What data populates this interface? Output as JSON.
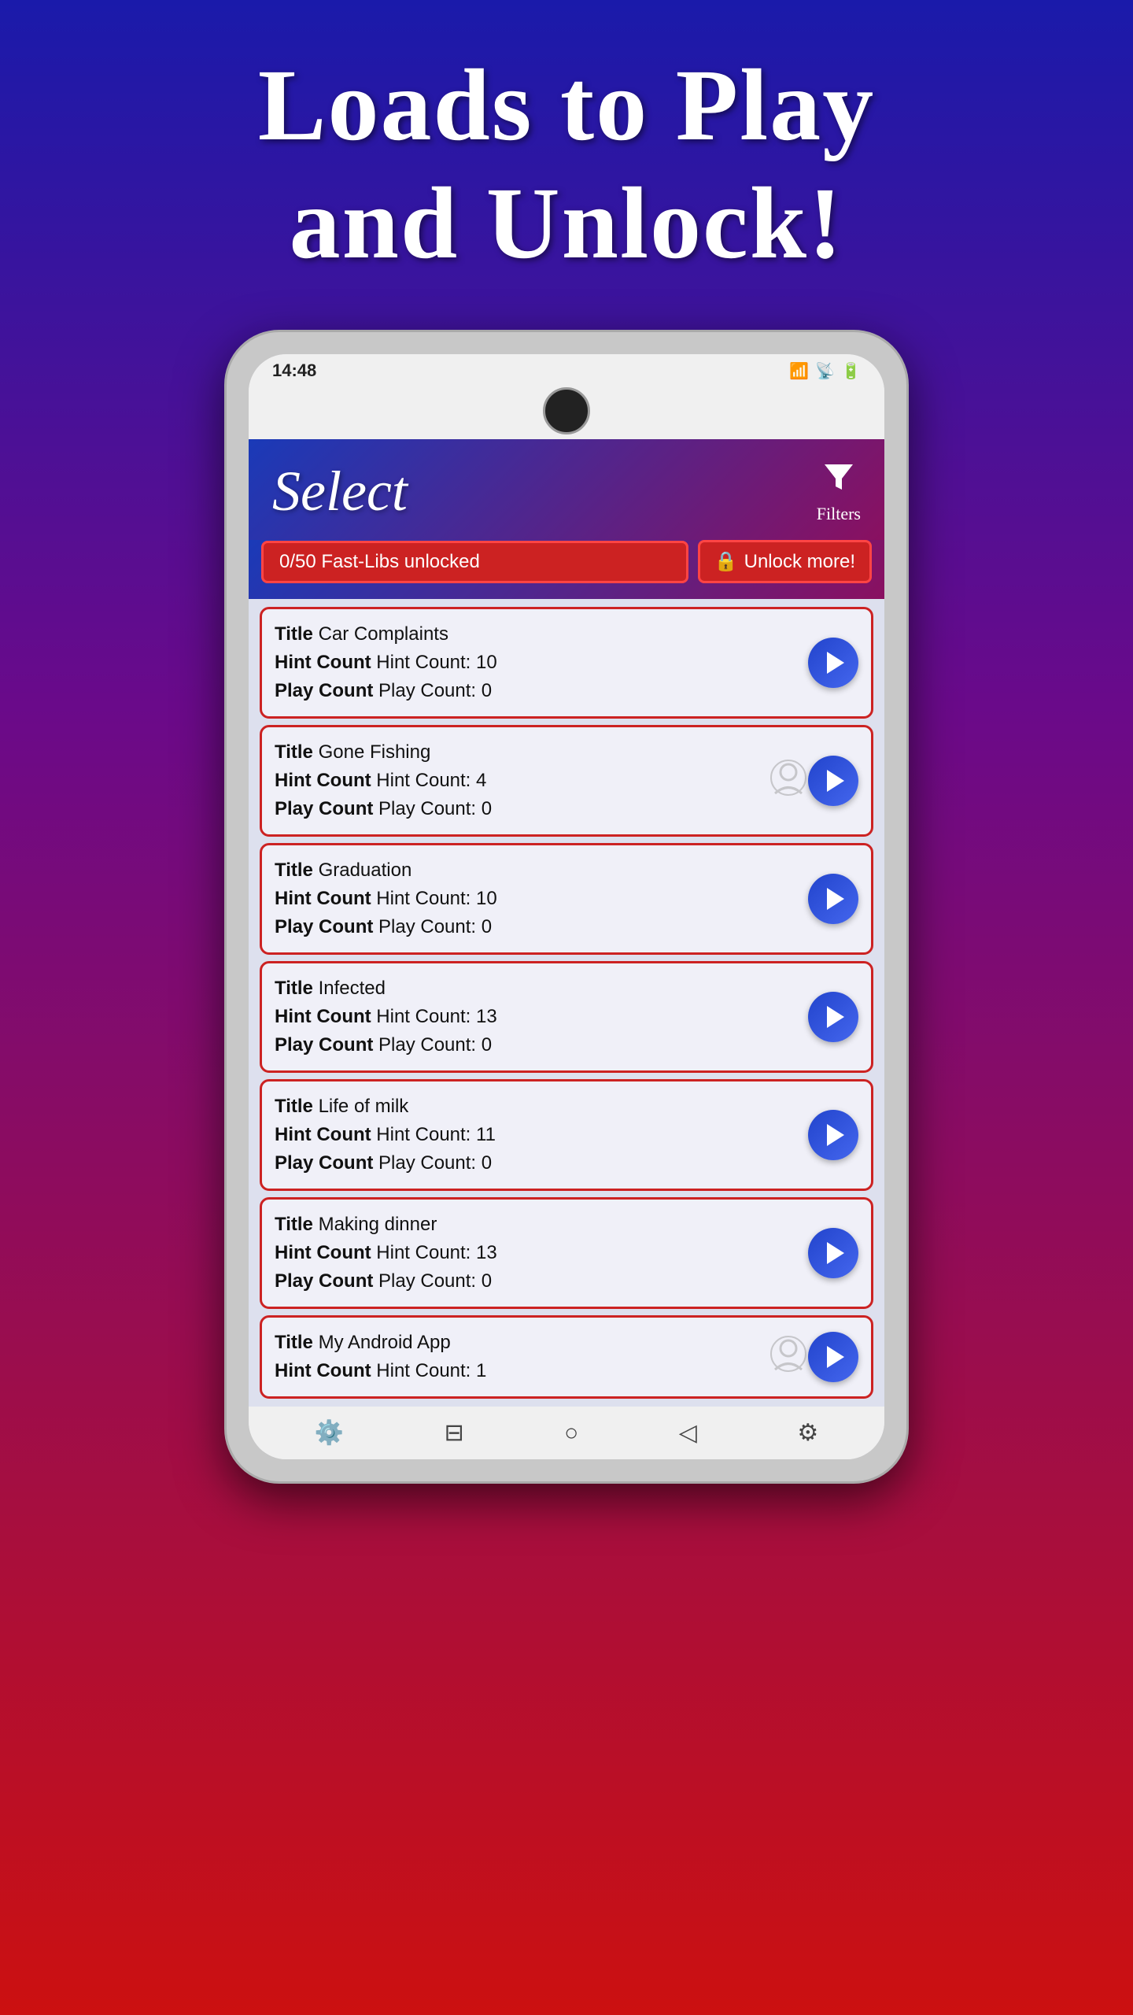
{
  "headline": {
    "line1": "Loads to Play",
    "line2": "and Unlock!"
  },
  "status_bar": {
    "time": "14:48",
    "icons": "📷 📱 🔋"
  },
  "app_header": {
    "title": "Select",
    "filter_label": "Filters"
  },
  "unlock_bar": {
    "fast_libs_label": "0/50 Fast-Libs unlocked",
    "unlock_btn_label": "Unlock more!"
  },
  "items": [
    {
      "title": "Car Complaints",
      "hint_count": "Hint Count: 10",
      "play_count": "Play Count: 0",
      "user_created": false
    },
    {
      "title": "Gone Fishing",
      "hint_count": "Hint Count: 4",
      "play_count": "Play Count: 0",
      "user_created": true
    },
    {
      "title": "Graduation",
      "hint_count": "Hint Count: 10",
      "play_count": "Play Count: 0",
      "user_created": false
    },
    {
      "title": "Infected",
      "hint_count": "Hint Count: 13",
      "play_count": "Play Count: 0",
      "user_created": false
    },
    {
      "title": "Life of milk",
      "hint_count": "Hint Count: 11",
      "play_count": "Play Count: 0",
      "user_created": false
    },
    {
      "title": "Making dinner",
      "hint_count": "Hint Count: 13",
      "play_count": "Play Count: 0",
      "user_created": false
    },
    {
      "title": "My Android App",
      "hint_count": "Hint Count: 1",
      "play_count": "",
      "user_created": true
    }
  ],
  "labels": {
    "title": "Title",
    "hint_count": "Hint Count",
    "play_count": "Play Count"
  },
  "nav": {
    "back": "⚙",
    "home": "⊙",
    "circle": "○",
    "triangle": "◁",
    "settings": "⚙"
  }
}
